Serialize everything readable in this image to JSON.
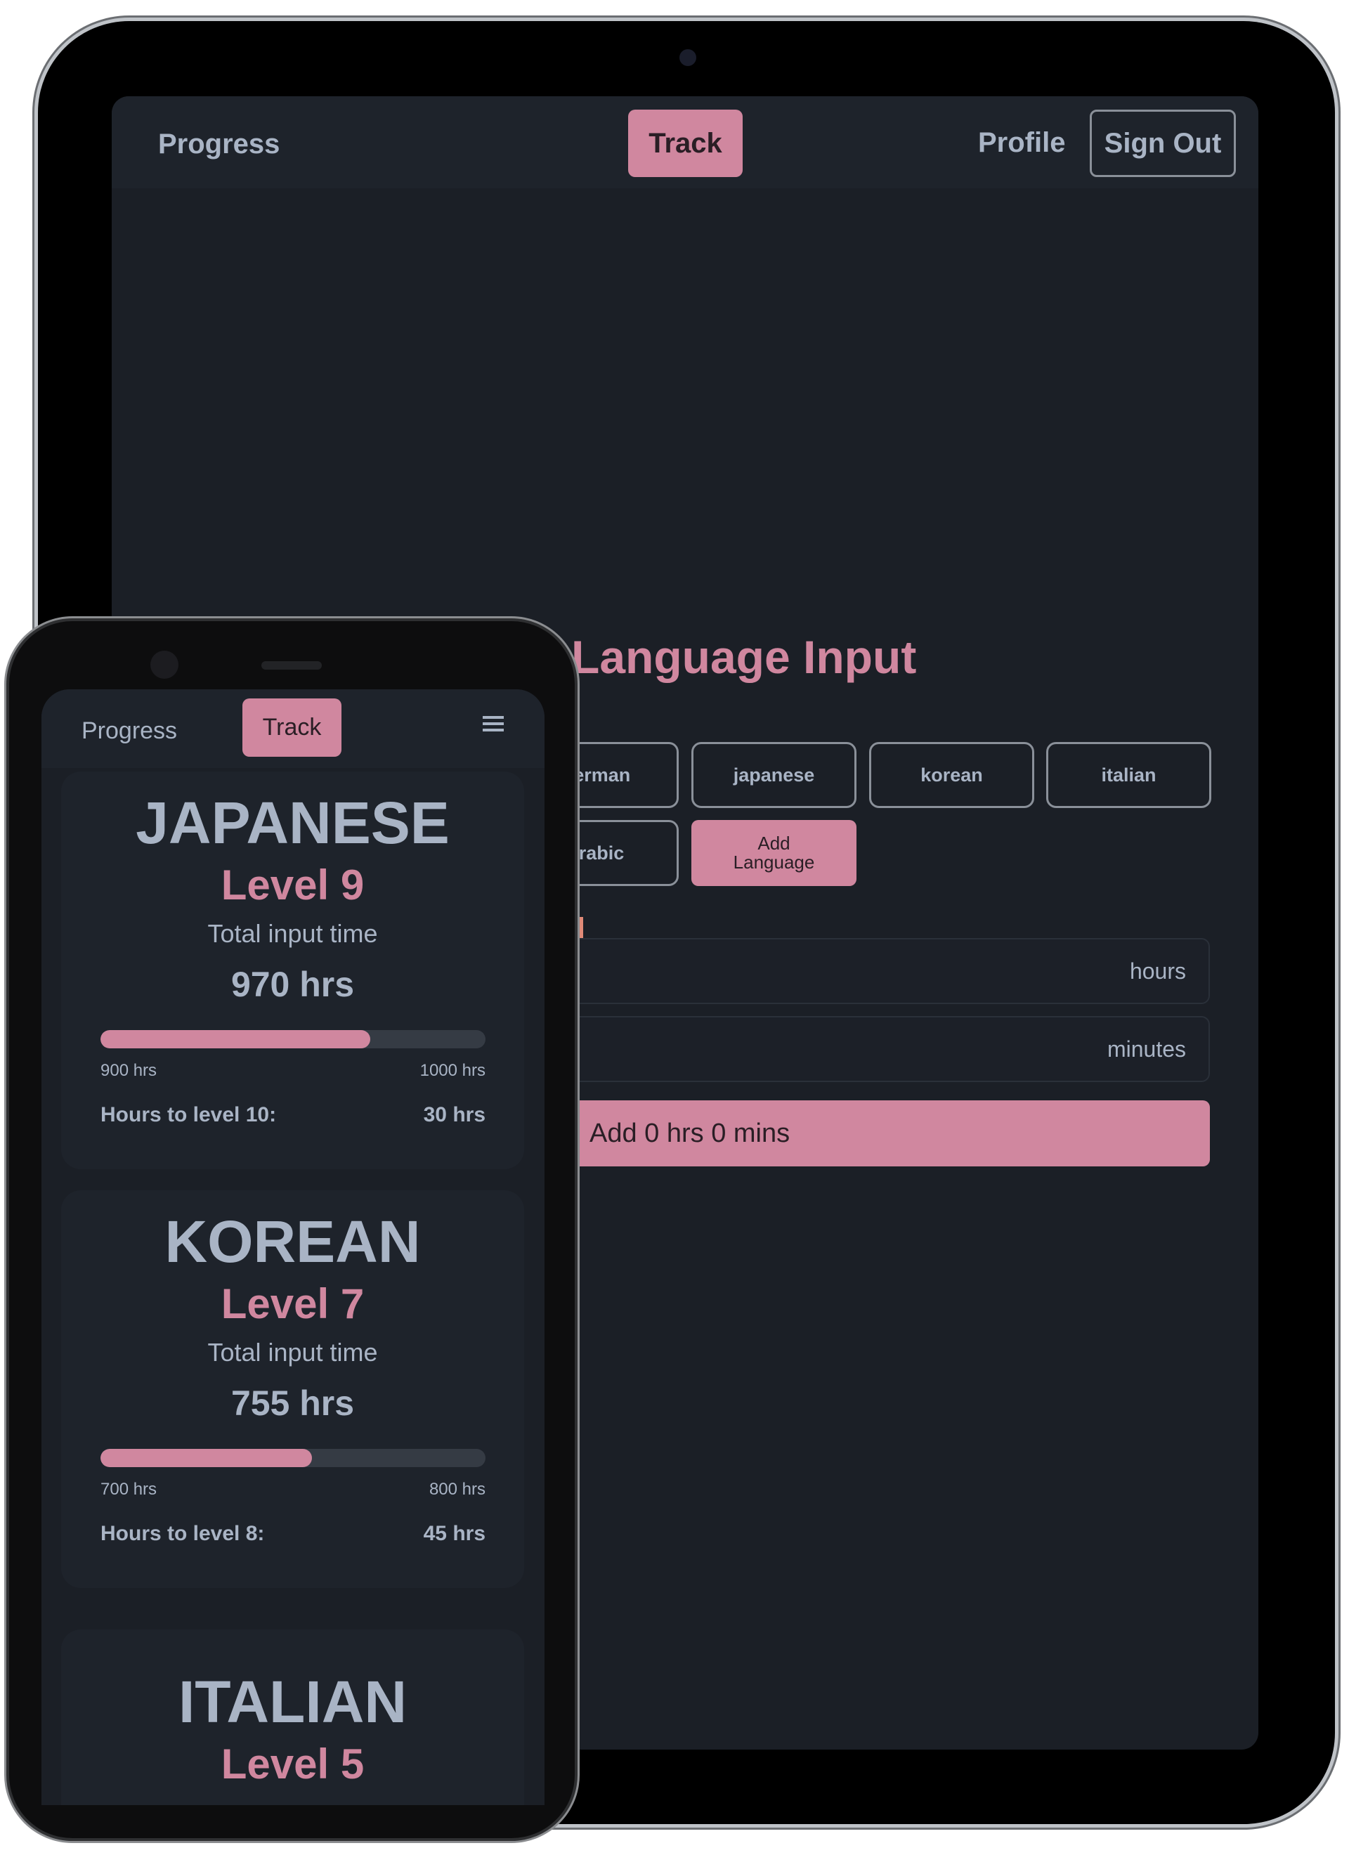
{
  "tablet": {
    "nav": {
      "progress": "Progress",
      "track": "Track",
      "profile": "Profile",
      "sign_out": "Sign Out"
    },
    "title": "Language Input",
    "languages": [
      "german",
      "japanese",
      "korean",
      "italian",
      "arabic"
    ],
    "add_language": "Add Language",
    "hours_label": "hours",
    "minutes_label": "minutes",
    "submit": "Add 0 hrs 0 mins"
  },
  "phone": {
    "nav": {
      "progress": "Progress",
      "track": "Track",
      "menu_icon": "hamburger-icon"
    },
    "cards": [
      {
        "name": "JAPANESE",
        "level": "Level 9",
        "total_label": "Total input time",
        "total": "970 hrs",
        "progress": 0.7,
        "min": "900 hrs",
        "max": "1000 hrs",
        "next_label": "Hours to level 10:",
        "next_value": "30 hrs"
      },
      {
        "name": "KOREAN",
        "level": "Level 7",
        "total_label": "Total input time",
        "total": "755 hrs",
        "progress": 0.55,
        "min": "700 hrs",
        "max": "800 hrs",
        "next_label": "Hours to level 8:",
        "next_value": "45 hrs"
      },
      {
        "name": "ITALIAN",
        "level": "Level 5"
      }
    ]
  },
  "colors": {
    "accent": "#d0879f",
    "background": "#1b1f26",
    "surface": "#1e232b",
    "text": "#a9b4c5"
  }
}
